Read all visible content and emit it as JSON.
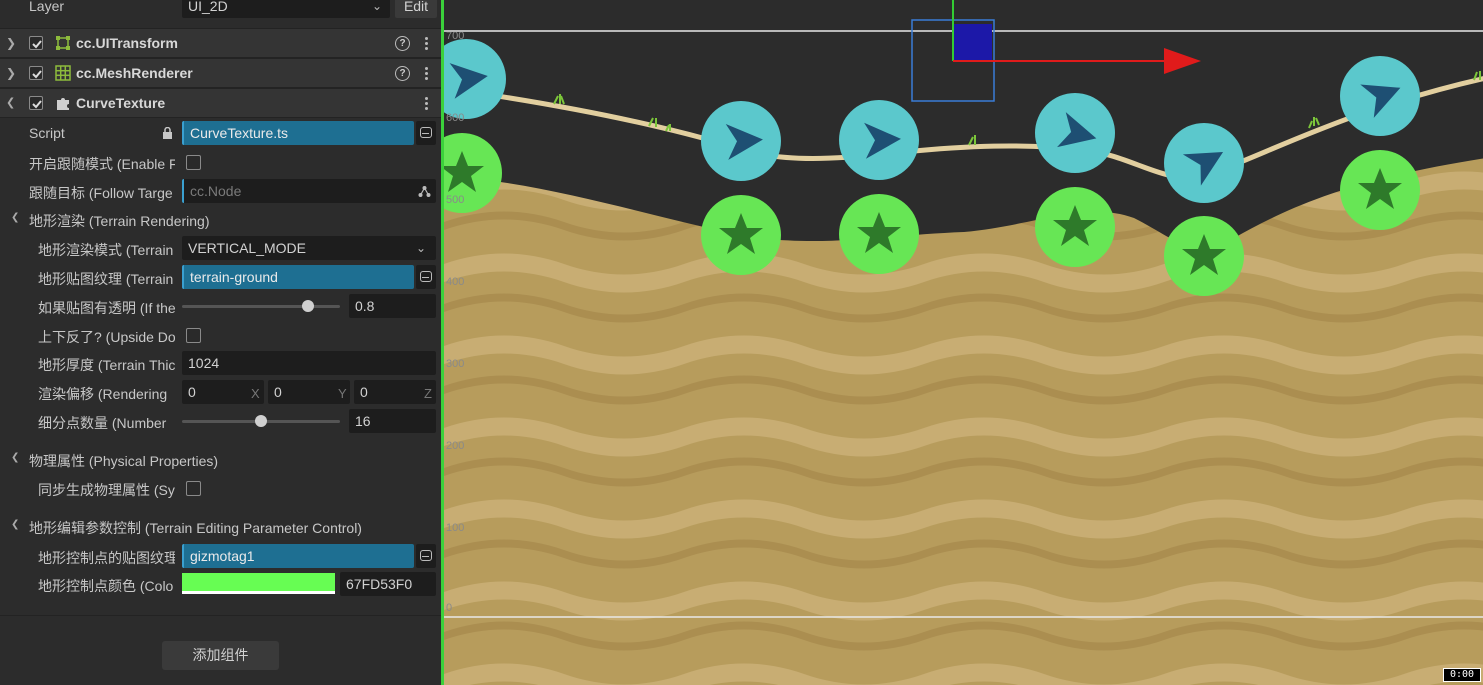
{
  "inspector": {
    "layer": {
      "label": "Layer",
      "value": "UI_2D",
      "edit_label": "Edit"
    },
    "components": [
      {
        "name": "cc.UITransform",
        "help": "?"
      },
      {
        "name": "cc.MeshRenderer",
        "help": "?"
      },
      {
        "name": "CurveTexture"
      }
    ],
    "props": {
      "script": {
        "label": "Script",
        "value": "CurveTexture.ts"
      },
      "enable_follow": {
        "label": "开启跟随模式 (Enable F"
      },
      "follow_target": {
        "label": "跟随目标 (Follow Targe",
        "value": "cc.Node"
      }
    },
    "terrain_rendering": {
      "title": "地形渲染 (Terrain Rendering)",
      "mode": {
        "label": "地形渲染模式 (Terrain",
        "value": "VERTICAL_MODE"
      },
      "texture": {
        "label": "地形贴图纹理 (Terrain",
        "value": "terrain-ground"
      },
      "transparent": {
        "label": "如果贴图有透明 (If the",
        "value": "0.8",
        "fraction": 0.8
      },
      "upside_down": {
        "label": "上下反了? (Upside Do"
      },
      "thickness": {
        "label": "地形厚度 (Terrain Thic",
        "value": "1024"
      },
      "offset": {
        "label": "渲染偏移 (Rendering",
        "x": "0",
        "y": "0",
        "z": "0",
        "x_label": "X",
        "y_label": "Y",
        "z_label": "Z"
      },
      "subdivision": {
        "label": "细分点数量 (Number",
        "value": "16",
        "fraction": 0.5
      }
    },
    "physical": {
      "title": "物理属性 (Physical Properties)",
      "sync": {
        "label": "同步生成物理属性 (Sy"
      }
    },
    "editing": {
      "title": "地形编辑参数控制 (Terrain Editing Parameter Control)",
      "point_texture": {
        "label": "地形控制点的贴图纹理",
        "value": "gizmotag1"
      },
      "point_color": {
        "label": "地形控制点颜色 (Colo",
        "value": "67FD53F0",
        "color": "#67FD53"
      }
    },
    "add_component": "添加组件"
  },
  "scene": {
    "y_ticks": [
      "700",
      "600",
      "500",
      "400",
      "300",
      "200",
      "100",
      "0"
    ],
    "status": "0:00",
    "colors": {
      "sand": "#b79c5c",
      "marker_cyan": "#5bc8cc",
      "marker_green": "#67e655",
      "bg": "#2c2c2c"
    }
  }
}
